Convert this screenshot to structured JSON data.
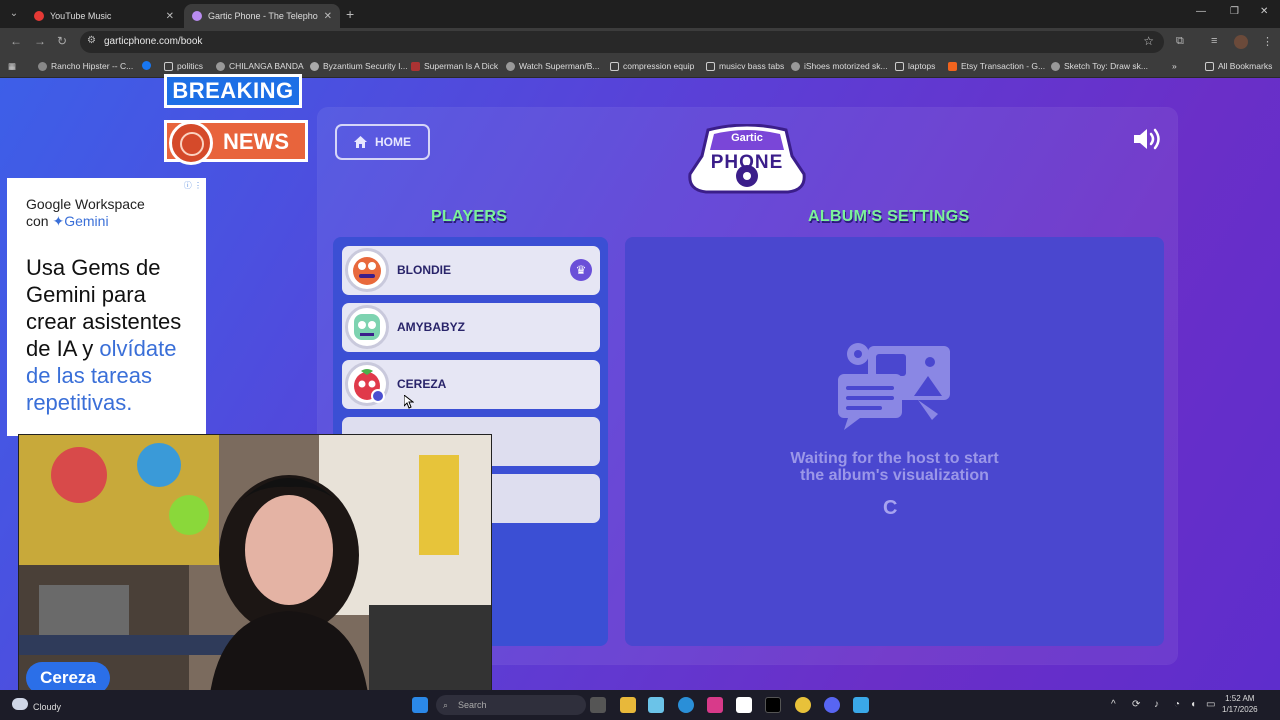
{
  "browser": {
    "tabs": [
      {
        "label": "YouTube Music",
        "active": false
      },
      {
        "label": "Gartic Phone - The Telephone G",
        "active": true
      }
    ],
    "url": "garticphone.com/book",
    "bookmarks": [
      "Rancho Hipster -- C...",
      "politics",
      "CHILANGA BANDA",
      "Byzantium Security I...",
      "Superman Is A Dick",
      "Watch Superman/B...",
      "compression equip",
      "musicv bass tabs",
      "iShoes motorized sk...",
      "laptops",
      "Etsy Transaction - G...",
      "Sketch Toy: Draw sk..."
    ],
    "all_bookmarks": "All Bookmarks"
  },
  "overlay": {
    "breaking": "BREAKING",
    "news": "NEWS"
  },
  "ad": {
    "line1": "Google Workspace",
    "line2_prefix": "con",
    "line2_brand": "Gemini",
    "headline_black": "Usa Gems de Gemini para crear asistentes de IA y",
    "headline_blue": "olvídate de las tareas repetitivas."
  },
  "game": {
    "home_label": "HOME",
    "logo_top": "Gartic",
    "logo_main": "PHONE",
    "players_title": "PLAYERS",
    "settings_title": "ALBUM'S SETTINGS",
    "players": [
      {
        "name": "BLONDIE",
        "host": true
      },
      {
        "name": "AMYBABYZ",
        "host": false
      },
      {
        "name": "CEREZA",
        "host": false
      },
      {
        "name": "",
        "host": false
      },
      {
        "name": "",
        "host": false
      }
    ],
    "waiting_line1": "Waiting for the host to start",
    "waiting_line2": "the album's visualization",
    "spinner": "C"
  },
  "webcam": {
    "name_tag": "Cereza"
  },
  "taskbar": {
    "weather": "Cloudy",
    "search_placeholder": "Search",
    "time": "1:52 AM",
    "date": "1/17/2026"
  },
  "colors": {
    "accent_green": "#7cf29a",
    "panel_blue": "#3b4fd4",
    "album_blue": "#4a47cf"
  }
}
